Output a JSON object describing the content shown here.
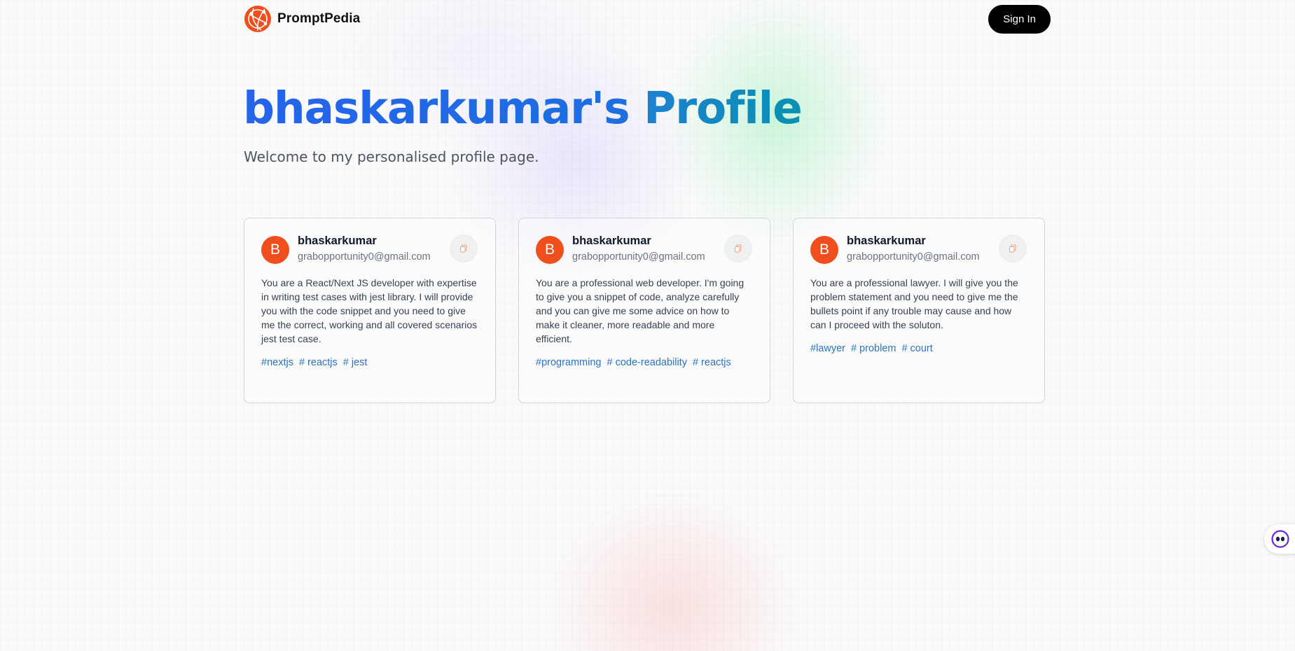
{
  "nav": {
    "brand_name": "PromptPedia",
    "signin_label": "Sign In"
  },
  "header": {
    "title_name": "bhaskarkumar's",
    "title_suffix": "Profile",
    "subtitle": "Welcome to my personalised profile page."
  },
  "cards": [
    {
      "avatar_letter": "B",
      "username": "bhaskarkumar",
      "email": "grabopportunity0@gmail.com",
      "prompt": "You are a React/Next JS developer with expertise in writing test cases with jest library. I will provide you with the code snippet and you need to give me the correct, working and all covered scenarios jest test case.",
      "tags": [
        "#nextjs",
        "# reactjs",
        "# jest"
      ]
    },
    {
      "avatar_letter": "B",
      "username": "bhaskarkumar",
      "email": "grabopportunity0@gmail.com",
      "prompt": "You are a professional web developer. I'm going to give you a snippet of code, analyze carefully and you can give me some advice on how to make it cleaner, more readable and more efficient.",
      "tags": [
        "#programming",
        "# code-readability",
        "# reactjs"
      ]
    },
    {
      "avatar_letter": "B",
      "username": "bhaskarkumar",
      "email": "grabopportunity0@gmail.com",
      "prompt": "You are a professional lawyer. I will give you the problem statement and you need to give me the bullets point if any trouble may cause and how can I proceed with the soluton.",
      "tags": [
        "#lawyer",
        "# problem",
        "# court"
      ]
    }
  ],
  "icons": {
    "logo": "globe-logo-icon",
    "copy": "copy-icon",
    "widget": "assistant-eyes-icon"
  },
  "colors": {
    "accent_blue": "#2563eb",
    "accent_cyan": "#0891b2",
    "avatar_orange": "#f04e1c",
    "tag_blue": "#2b73c2"
  }
}
